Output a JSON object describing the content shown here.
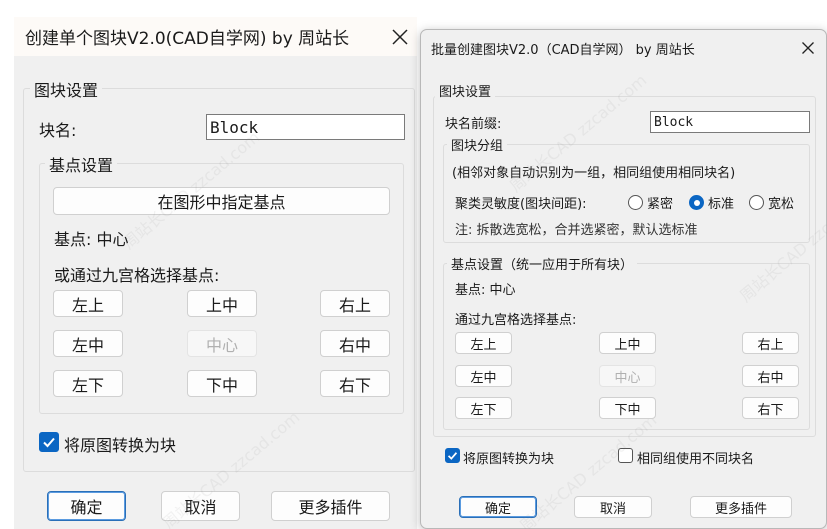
{
  "dialog1": {
    "title": "创建单个图块V2.0(CAD自学网) by 周站长",
    "group_block_settings": "图块设置",
    "block_name_label": "块名:",
    "block_name_value": "Block",
    "group_base_point": "基点设置",
    "pick_base_button": "在图形中指定基点",
    "base_point_status": "基点: 中心",
    "grid_prompt": "或通过九宫格选择基点:",
    "grid": [
      "左上",
      "上中",
      "右上",
      "左中",
      "中心",
      "右中",
      "左下",
      "下中",
      "右下"
    ],
    "grid_disabled_index": 4,
    "convert_checkbox_label": "将原图转换为块",
    "convert_checked": true,
    "ok_label": "确定",
    "cancel_label": "取消",
    "more_label": "更多插件"
  },
  "dialog2": {
    "title": "批量创建图块V2.0（CAD自学网） by 周站长",
    "group_block_settings": "图块设置",
    "prefix_label": "块名前缀:",
    "prefix_value": "Block",
    "group_grouping": "图块分组",
    "grouping_desc": "(相邻对象自动识别为一组，相同组使用相同块名)",
    "sensitivity_label": "聚类灵敏度(图块间距):",
    "sensitivity_options": [
      "紧密",
      "标准",
      "宽松"
    ],
    "sensitivity_selected": "标准",
    "note": "注: 拆散选宽松，合并选紧密，默认选标准",
    "group_base_point": "基点设置（统一应用于所有块）",
    "base_point_status": "基点: 中心",
    "grid_prompt": "通过九宫格选择基点:",
    "grid": [
      "左上",
      "上中",
      "右上",
      "左中",
      "中心",
      "右中",
      "左下",
      "下中",
      "右下"
    ],
    "grid_disabled_index": 4,
    "convert_checkbox_label": "将原图转换为块",
    "convert_checked": true,
    "diff_name_checkbox_label": "相同组使用不同块名",
    "diff_name_checked": false,
    "ok_label": "确定",
    "cancel_label": "取消",
    "more_label": "更多插件"
  },
  "icons": {
    "close": "close-icon",
    "check": "checkmark-icon"
  },
  "colors": {
    "accent": "#0b66c3",
    "dialog_bg": "#f0f0f0",
    "titlebar_bg": "#fdfaf7"
  }
}
